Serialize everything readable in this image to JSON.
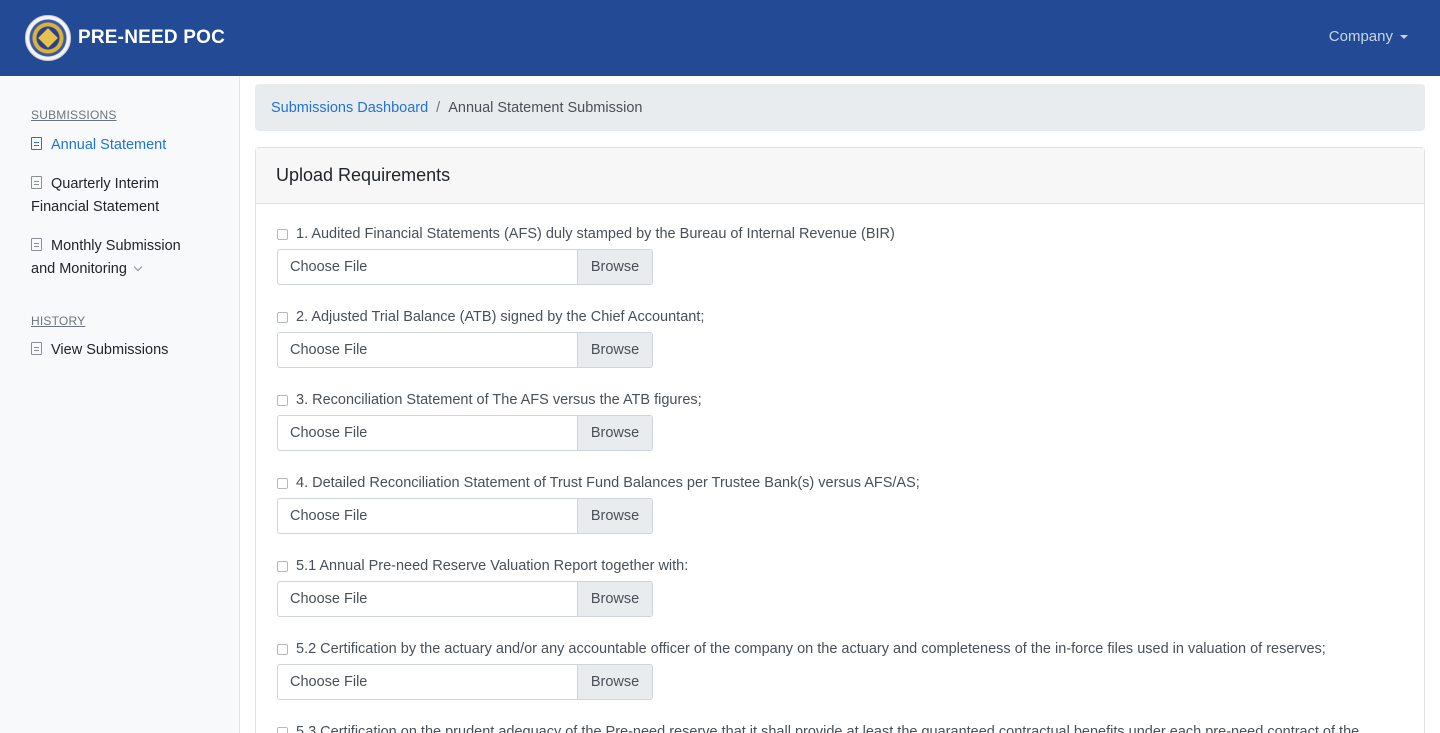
{
  "navbar": {
    "brand": "PRE-NEED POC",
    "company_menu": "Company"
  },
  "sidebar": {
    "submissions_heading": "SUBMISSIONS",
    "history_heading": "HISTORY",
    "items": [
      {
        "label": "Annual Statement"
      },
      {
        "label": "Quarterly Interim Financial Statement"
      },
      {
        "label": "Monthly Submission and Monitoring"
      },
      {
        "label": "View Submissions"
      }
    ]
  },
  "breadcrumb": {
    "link": "Submissions Dashboard",
    "separator": "/",
    "current": "Annual Statement Submission"
  },
  "card": {
    "title": "Upload Requirements",
    "choose_file_label": "Choose File",
    "browse_label": "Browse",
    "requirements": [
      "1. Audited Financial Statements (AFS) duly stamped by the Bureau of Internal Revenue (BIR)",
      "2. Adjusted Trial Balance (ATB) signed by the Chief Accountant;",
      "3. Reconciliation Statement of The AFS versus the ATB figures;",
      "4. Detailed Reconciliation Statement of Trust Fund Balances per Trustee Bank(s) versus AFS/AS;",
      "5.1 Annual Pre-need Reserve Valuation Report together with:",
      "5.2 Certification by the actuary and/or any accountable officer of the company on the actuary and completeness of the in-force files used in valuation of reserves;",
      "5.3 Certification on the prudent adequacy of the Pre-need reserve that it shall provide at least the guaranteed contractual benefits under each pre-need contract of the"
    ]
  }
}
